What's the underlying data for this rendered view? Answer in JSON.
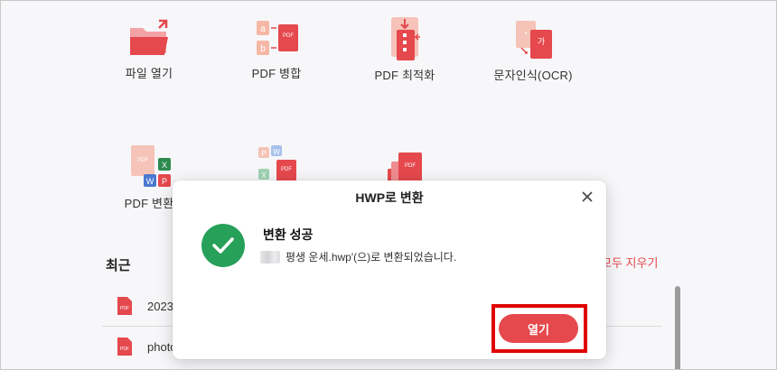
{
  "tools": [
    {
      "label": "파일 열기",
      "icon": "folder-open-icon"
    },
    {
      "label": "PDF 병합",
      "icon": "pdf-merge-icon"
    },
    {
      "label": "PDF 최적화",
      "icon": "pdf-compress-icon"
    },
    {
      "label": "문자인식(OCR)",
      "icon": "ocr-icon"
    },
    {
      "label": "PDF 변환",
      "icon": "pdf-convert-icon"
    },
    {
      "label": "",
      "icon": "office-to-pdf-icon"
    },
    {
      "label": "",
      "icon": "pdf-pages-icon"
    }
  ],
  "tool_glyphs": {
    "pdf": "PDF",
    "ocr_char": "가",
    "merge_a": "a",
    "merge_b": "b",
    "word": "W",
    "excel": "X",
    "ppt": "P"
  },
  "recent": {
    "title": "최근",
    "clear_all": "모두 지우기",
    "items": [
      {
        "name": "2023",
        "icon": "pdf-file-icon"
      },
      {
        "name": "photo",
        "icon": "pdf-file-icon"
      }
    ],
    "file_icon_text": "PDF"
  },
  "dialog": {
    "title": "HWP로 변환",
    "heading": "변환 성공",
    "message": "평생 운세.hwp'(으)로 변환되었습니다.",
    "open_button": "열기"
  },
  "colors": {
    "accent": "#e5484d",
    "success": "#27a05a",
    "highlight": "#e00000"
  }
}
